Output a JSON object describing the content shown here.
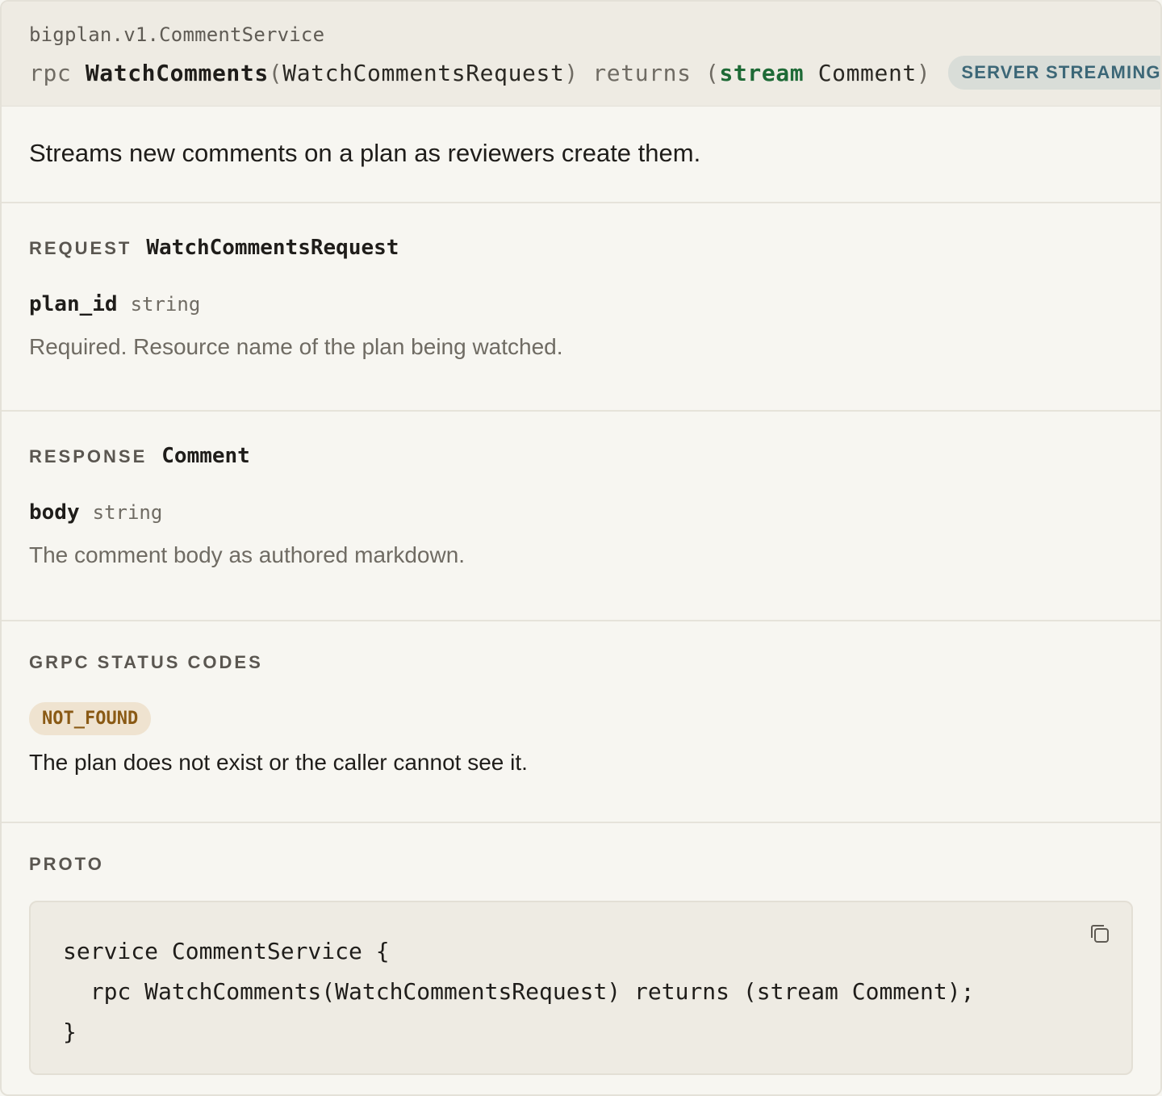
{
  "header": {
    "package_service": "bigplan.v1.CommentService",
    "sig_rpc": "rpc ",
    "method_name": "WatchComments",
    "sig_open": "(",
    "request_type": "WatchCommentsRequest",
    "sig_returns": ") returns (",
    "stream_kw": "stream",
    "response_type": "Comment",
    "sig_close": ")",
    "streaming_badge": "SERVER STREAMING"
  },
  "description": "Streams new comments on a plan as reviewers create them.",
  "request": {
    "label": "REQUEST",
    "message": "WatchCommentsRequest",
    "field_name": "plan_id",
    "field_type": "string",
    "field_desc": "Required. Resource name of the plan being watched."
  },
  "response": {
    "label": "RESPONSE",
    "message": "Comment",
    "field_name": "body",
    "field_type": "string",
    "field_desc": "The comment body as authored markdown."
  },
  "status_codes": {
    "label": "GRPC STATUS CODES",
    "code": "NOT_FOUND",
    "code_desc": "The plan does not exist or the caller cannot see it."
  },
  "proto": {
    "label": "PROTO",
    "code": "service CommentService {\n  rpc WatchComments(WatchCommentsRequest) returns (stream Comment);\n}",
    "copy_icon": "copy-icon"
  },
  "colors": {
    "stream_keyword": "#1e6a36",
    "streaming_badge_text": "#3c6777",
    "status_badge_bg": "#efe3d0",
    "status_badge_text": "#8a5a15"
  }
}
